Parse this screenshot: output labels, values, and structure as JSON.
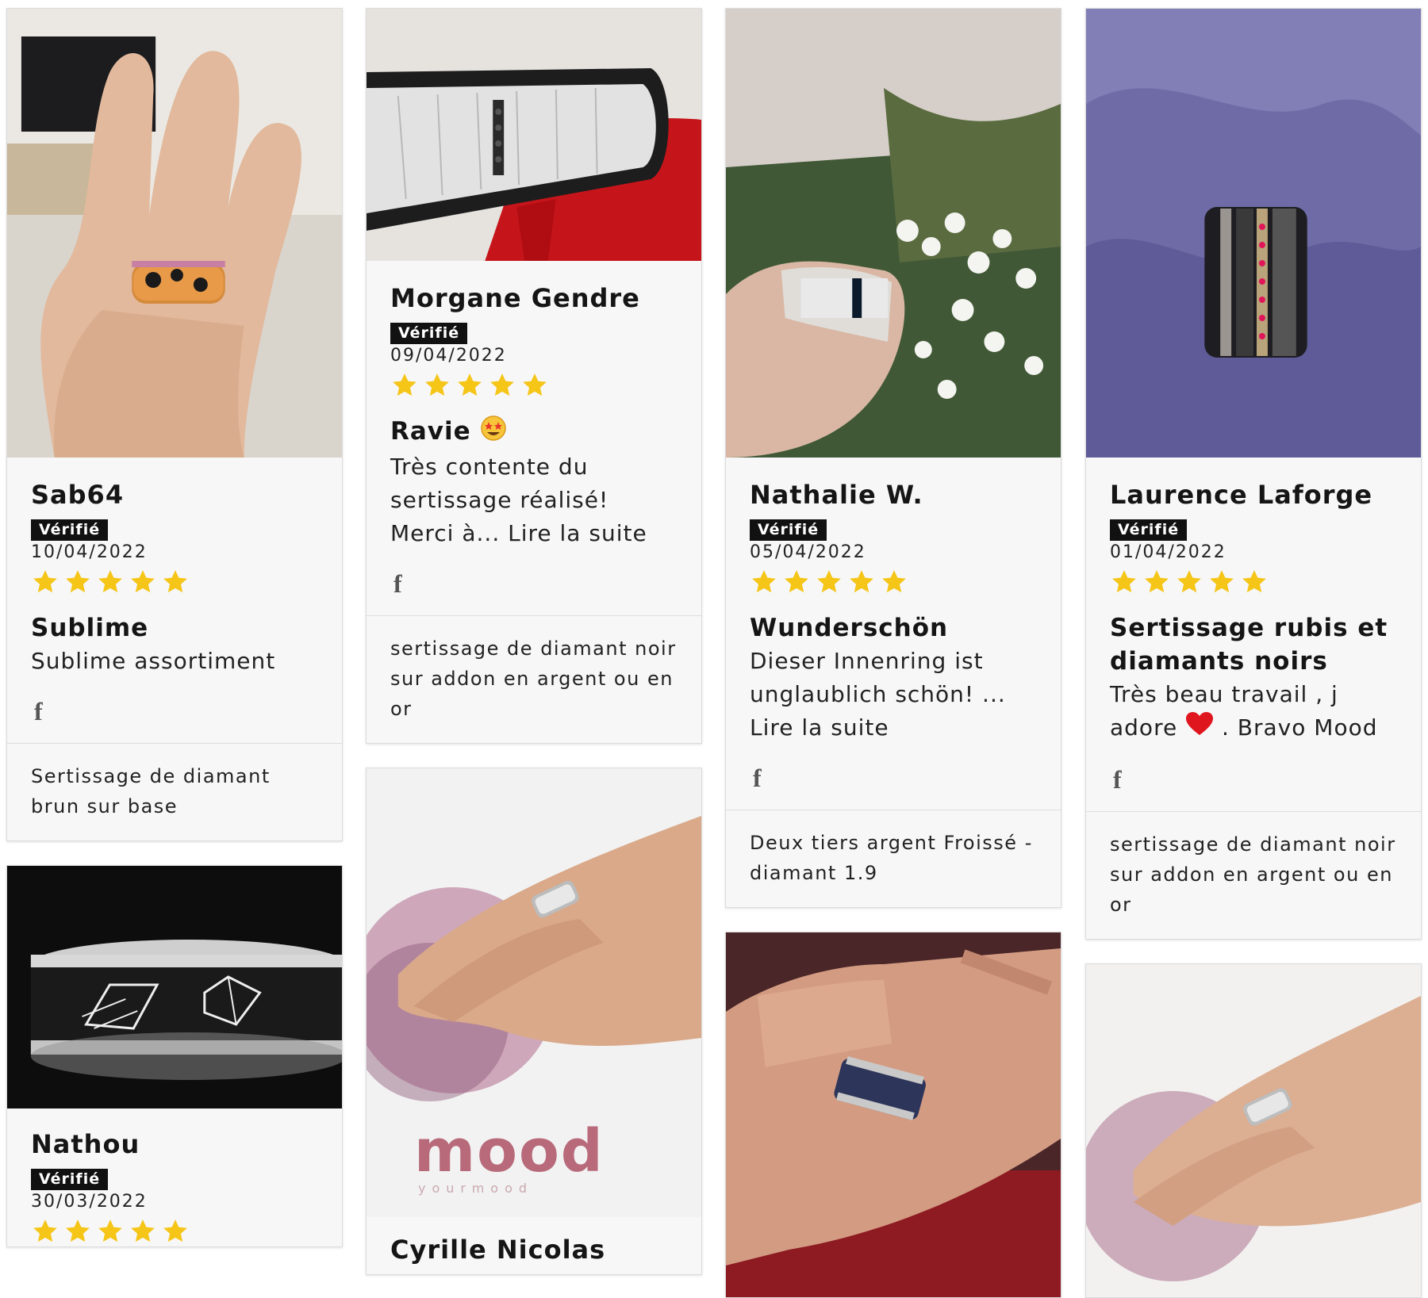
{
  "verified_label": "Vérifié",
  "read_more": "Lire la suite",
  "facebook_glyph": "f",
  "star_color": "#f5c518",
  "rating_max": 5,
  "reviews": [
    {
      "author": "Sab64",
      "date": "10/04/2022",
      "rating": 5,
      "title": "Sublime",
      "text": "Sublime assortiment",
      "product": "Sertissage de diamant brun sur base"
    },
    {
      "author": "Nathou",
      "date": "30/03/2022",
      "rating": 5
    },
    {
      "author": "Morgane Gendre",
      "date": "09/04/2022",
      "rating": 5,
      "title": "Ravie",
      "text": "Très contente du sertissage réalisé! Merci à...",
      "product": "sertissage de diamant noir sur addon en argent ou en or"
    },
    {
      "author": "Cyrille Nicolas",
      "logo_text": "mood",
      "logo_sub": "yourmood"
    },
    {
      "author": "Nathalie W.",
      "date": "05/04/2022",
      "rating": 5,
      "title": "Wunderschön",
      "text": "Dieser Innenring ist unglaublich schön! ...",
      "product": "Deux tiers argent Froissé - diamant 1.9"
    },
    {
      "author": "Laurence Laforge",
      "date": "01/04/2022",
      "rating": 5,
      "title": "Sertissage rubis et diamants noirs",
      "text_before_emoji": "Très beau travail , j adore",
      "text_after_emoji": ". Bravo Mood",
      "product": "sertissage de diamant noir sur addon en argent ou en or"
    }
  ]
}
